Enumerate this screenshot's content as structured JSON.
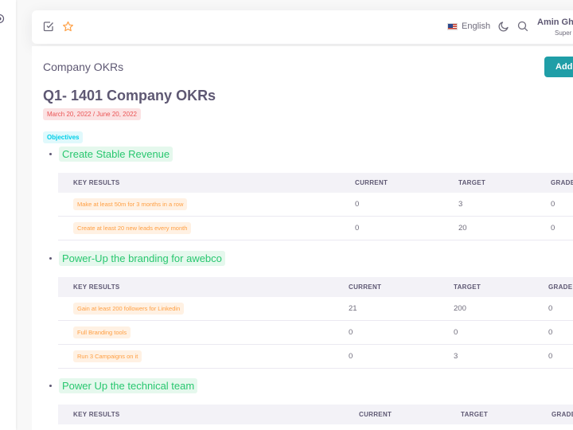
{
  "navbar": {
    "language": "English",
    "user_name": "Amin Gh",
    "user_role": "Super"
  },
  "page": {
    "title": "Company OKRs",
    "add_label": "Add"
  },
  "okr": {
    "title": "Q1- 1401 Company OKRs",
    "date_range": "March 20, 2022 / June 20, 2022",
    "objectives_label": "Objectives"
  },
  "objectives": [
    {
      "name": "Create Stable Revenue",
      "headers": [
        "KEY RESULTS",
        "CURRENT",
        "TARGET",
        "GRADE"
      ],
      "rows": [
        {
          "kr": "Make at least 50m for 3 months in a row",
          "current": "0",
          "target": "3",
          "grade": "0"
        },
        {
          "kr": "Create at least 20 new leads every month",
          "current": "0",
          "target": "20",
          "grade": "0"
        }
      ]
    },
    {
      "name": "Power-Up the branding for awebco",
      "headers": [
        "KEY RESULTS",
        "CURRENT",
        "TARGET",
        "GRADE"
      ],
      "rows": [
        {
          "kr": "Gain at least 200 followers for Linkedin",
          "current": "21",
          "target": "200",
          "grade": "0"
        },
        {
          "kr": "Full Branding tools",
          "current": "0",
          "target": "0",
          "grade": "0"
        },
        {
          "kr": "Run 3 Campaigns on it",
          "current": "0",
          "target": "3",
          "grade": "0"
        }
      ]
    },
    {
      "name": "Power Up the technical team",
      "headers": [
        "KEY RESULTS",
        "CURRENT",
        "TARGET",
        "GRADE"
      ],
      "rows": []
    }
  ]
}
